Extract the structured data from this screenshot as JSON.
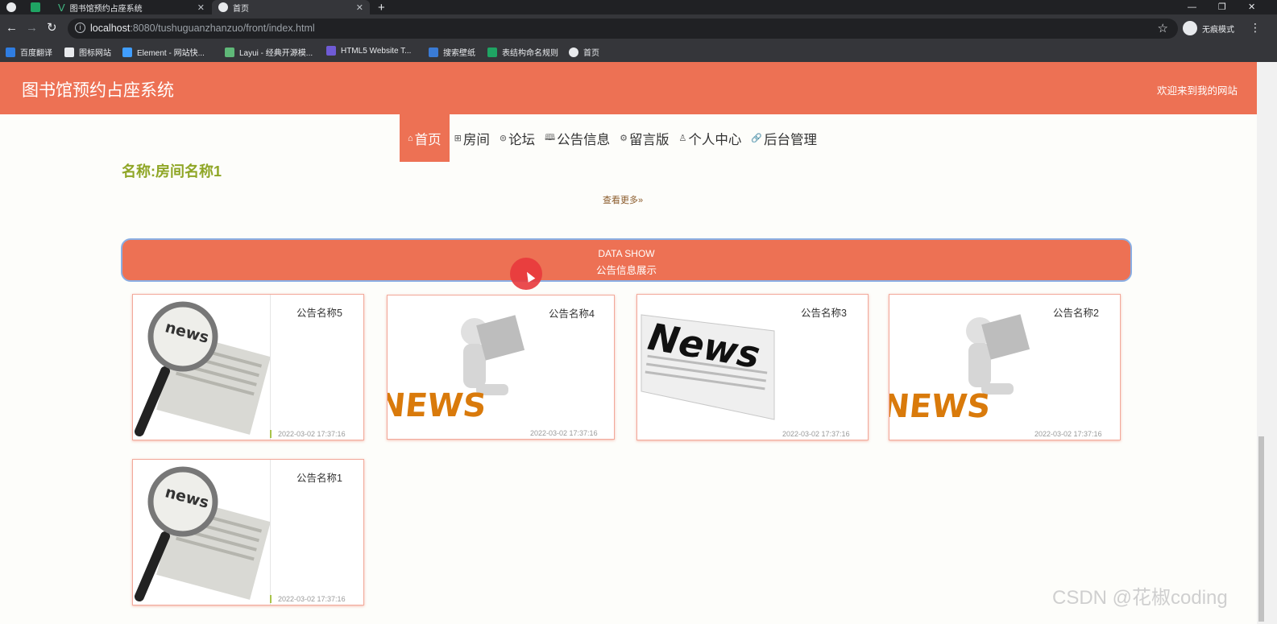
{
  "browser": {
    "tabs": [
      {
        "title": "图书馆预约占座系统"
      },
      {
        "title": "首页"
      }
    ],
    "address": {
      "host": "localhost",
      "path": ":8080/tushuguanzhanzuo/front/index.html"
    },
    "incognito_label": "无痕模式",
    "bookmarks": [
      {
        "label": "百度翻译",
        "color": "#2f7de1"
      },
      {
        "label": "图标网站",
        "color": "#e8eaed"
      },
      {
        "label": "Element - 网站快...",
        "color": "#409eff"
      },
      {
        "label": "Layui - 经典开源模...",
        "color": "#5fb878"
      },
      {
        "label": "HTML5 Website T...",
        "color": "#6f5bd6"
      },
      {
        "label": "搜索壁纸",
        "color": "#3a7bd5"
      },
      {
        "label": "表结构命名规则",
        "color": "#1fa463"
      },
      {
        "label": "首页",
        "color": "#e8eaed"
      }
    ]
  },
  "header": {
    "site_title": "图书馆预约占座系统",
    "welcome": "欢迎来到我的网站"
  },
  "nav": [
    {
      "label": "首页",
      "icon": "home-icon",
      "glyph": "⌂"
    },
    {
      "label": "房间",
      "icon": "room-icon",
      "glyph": "⊞"
    },
    {
      "label": "论坛",
      "icon": "forum-icon",
      "glyph": "⊜"
    },
    {
      "label": "公告信息",
      "icon": "book-icon",
      "glyph": "🕮"
    },
    {
      "label": "留言版",
      "icon": "gear-icon",
      "glyph": "⚙"
    },
    {
      "label": "个人中心",
      "icon": "user-icon",
      "glyph": "♙"
    },
    {
      "label": "后台管理",
      "icon": "link-icon",
      "glyph": "🔗"
    }
  ],
  "room": {
    "name": "名称:房间名称1"
  },
  "more_link": "查看更多",
  "banner": {
    "en": "DATA SHOW",
    "cn": "公告信息展示"
  },
  "notices": [
    {
      "title": "公告名称5",
      "date": "2022-03-02 17:37:16",
      "image": "magnifier-news"
    },
    {
      "title": "公告名称4",
      "date": "2022-03-02 17:37:16",
      "image": "figure-news"
    },
    {
      "title": "公告名称3",
      "date": "2022-03-02 17:37:16",
      "image": "newspaper-news"
    },
    {
      "title": "公告名称2",
      "date": "2022-03-02 17:37:16",
      "image": "figure-news"
    },
    {
      "title": "公告名称1",
      "date": "2022-03-02 17:37:16",
      "image": "magnifier-news"
    }
  ],
  "watermark": "CSDN @花椒coding",
  "colors": {
    "brand": "#ed7154",
    "room_name": "#8fa626",
    "banner_border": "#8aaee3"
  }
}
